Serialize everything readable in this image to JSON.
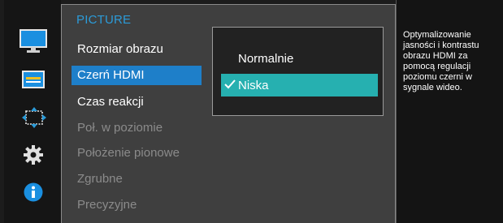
{
  "menu": {
    "title": "PICTURE",
    "items": [
      {
        "label": "Rozmiar obrazu",
        "state": "normal"
      },
      {
        "label": "Czerń HDMI",
        "state": "selected"
      },
      {
        "label": "Czas reakcji",
        "state": "normal"
      },
      {
        "label": "Poł. w poziomie",
        "state": "disabled"
      },
      {
        "label": "Położenie pionowe",
        "state": "disabled"
      },
      {
        "label": "Zgrubne",
        "state": "disabled"
      },
      {
        "label": "Precyzyjne",
        "state": "disabled"
      }
    ]
  },
  "submenu": {
    "options": [
      {
        "label": "Normalnie",
        "selected": false
      },
      {
        "label": "Niska",
        "selected": true
      }
    ],
    "check_icon": "check-icon"
  },
  "help": {
    "text": "Optymalizowanie jasności i kontrastu obrazu HDMI za pomocą regulacji poziomu czerni w sygnale wideo."
  },
  "sidebar": {
    "icons": [
      "picture-icon",
      "onscreen-display-icon",
      "position-icon",
      "settings-gear-icon",
      "info-icon"
    ]
  },
  "colors": {
    "accent_title": "#2b9bd8",
    "selected_item": "#1e7fc9",
    "selected_option": "#26b0b0",
    "disabled_text": "#8b8b8b"
  }
}
